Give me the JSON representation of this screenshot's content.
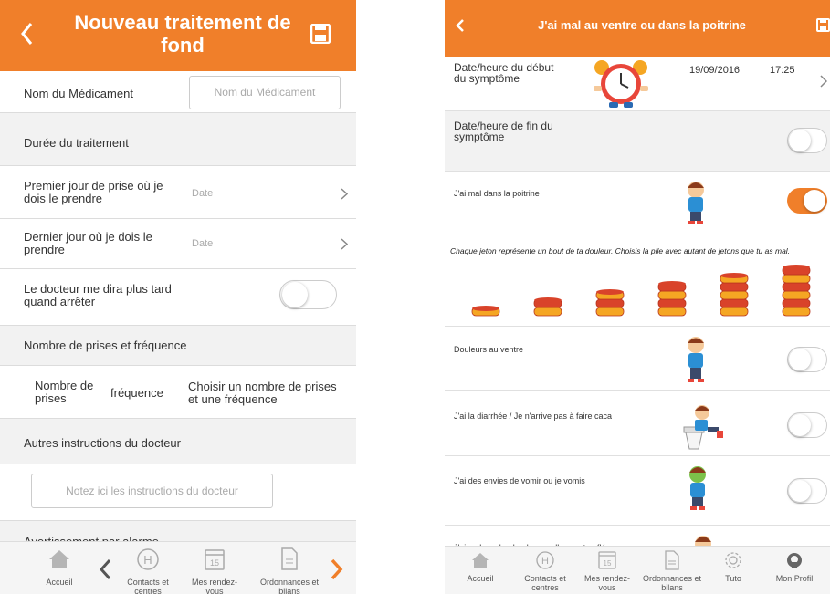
{
  "left": {
    "header": {
      "title": "Nouveau traitement de fond"
    },
    "medicament": {
      "label": "Nom du Médicament",
      "placeholder": "Nom du Médicament"
    },
    "duree": {
      "label": "Durée du traitement"
    },
    "premier": {
      "label": "Premier jour de prise où je dois le prendre",
      "placeholder": "Date"
    },
    "dernier": {
      "label": "Dernier jour où je dois le prendre",
      "placeholder": "Date"
    },
    "docteur_arreter": {
      "label": "Le docteur me dira plus tard quand arrêter",
      "toggle_on": false
    },
    "prises": {
      "label": "Nombre de prises et fréquence"
    },
    "prises_cols": {
      "nombre": "Nombre de prises",
      "frequence": "fréquence",
      "choisir": "Choisir un nombre de prises et une fréquence"
    },
    "autres": {
      "label": "Autres instructions du docteur"
    },
    "instructions": {
      "placeholder": "Notez ici les instructions du docteur"
    },
    "alarme": {
      "label": "Avertissement par alarme"
    },
    "nav": [
      {
        "label": "Accueil",
        "icon": "house-icon"
      },
      {
        "label": "Contacts et centres",
        "icon": "hospital-icon"
      },
      {
        "label": "Mes rendez-vous",
        "icon": "calendar-icon"
      },
      {
        "label": "Ordonnances et bilans",
        "icon": "document-icon"
      }
    ],
    "calendar_day": "15"
  },
  "right": {
    "header": {
      "title": "J'ai mal au ventre ou dans la poitrine"
    },
    "debut": {
      "label": "Date/heure du début du symptôme",
      "date": "19/09/2016",
      "time": "17:25"
    },
    "fin": {
      "label": "Date/heure de fin du symptôme",
      "toggle_on": false
    },
    "poitrine": {
      "label": "J'ai mal dans la poitrine",
      "toggle_on": true
    },
    "info_text": "Chaque jeton représente un bout de ta douleur. Choisis la pile avec autant de jetons que tu as mal.",
    "coin_piles": [
      1,
      2,
      3,
      4,
      5,
      6
    ],
    "symptoms": [
      {
        "label": "Douleurs au ventre",
        "toggle_on": false
      },
      {
        "label": "J'ai la diarrhée / Je n'arrive pas à faire caca",
        "toggle_on": false
      },
      {
        "label": "J'ai des envies de vomir ou je vomis",
        "toggle_on": false
      },
      {
        "label": "J'ai mal aux bouboules ou elles sont enflées",
        "toggle_on": false
      }
    ],
    "nav": [
      {
        "label": "Accueil",
        "icon": "house-icon"
      },
      {
        "label": "Contacts et centres",
        "icon": "hospital-icon"
      },
      {
        "label": "Mes rendez-vous",
        "icon": "calendar-icon"
      },
      {
        "label": "Ordonnances et bilans",
        "icon": "document-icon"
      },
      {
        "label": "Tuto",
        "icon": "gear-icon"
      },
      {
        "label": "Mon Profil",
        "icon": "profile-icon"
      }
    ],
    "calendar_day": "15"
  },
  "colors": {
    "accent": "#f07f2a",
    "coin_red": "#d9432a",
    "coin_gold": "#f5a623"
  }
}
